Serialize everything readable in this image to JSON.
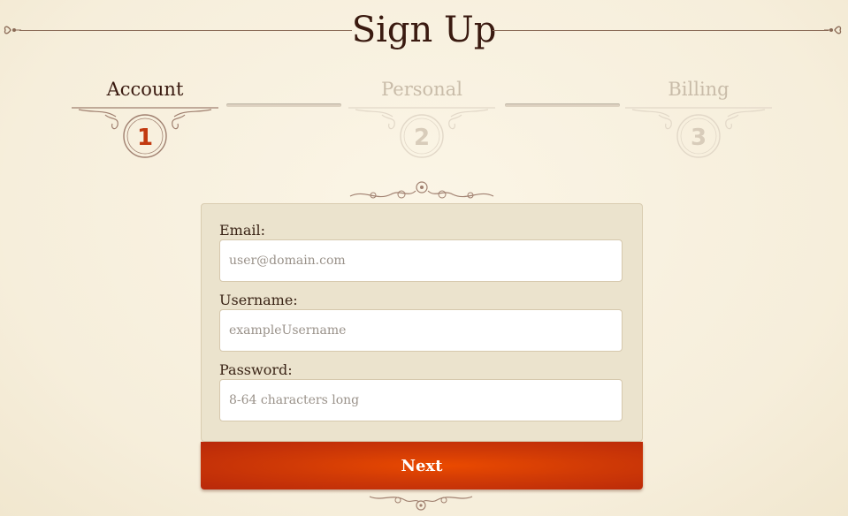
{
  "page": {
    "title": "Sign Up"
  },
  "steps": [
    {
      "number": "1",
      "label": "Account",
      "state": "active"
    },
    {
      "number": "2",
      "label": "Personal",
      "state": "inactive"
    },
    {
      "number": "3",
      "label": "Billing",
      "state": "inactive"
    }
  ],
  "form": {
    "email": {
      "label": "Email:",
      "placeholder": "user@domain.com",
      "value": ""
    },
    "username": {
      "label": "Username:",
      "placeholder": "exampleUsername",
      "value": ""
    },
    "password": {
      "label": "Password:",
      "placeholder": "8-64 characters long",
      "value": ""
    },
    "next_label": "Next"
  },
  "colors": {
    "accent": "#d63c04",
    "active_step": "#3a1a10",
    "inactive_step": "#c9bca9",
    "ornament": "#a08070",
    "card": "#ebe3cd"
  },
  "icons": {
    "header_flourish": "fleur-icon",
    "step_ornament": "scroll-medallion-icon"
  }
}
